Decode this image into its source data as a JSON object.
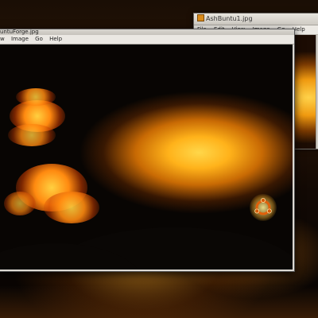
{
  "back_window": {
    "title": "AshBuntu1.jpg",
    "menu": [
      "File",
      "Edit",
      "View",
      "Image",
      "Go",
      "Help"
    ]
  },
  "main_window": {
    "title": "untuForge.jpg",
    "menu": [
      "w",
      "Image",
      "Go",
      "Help"
    ]
  },
  "icons": {
    "back_title_icon": "image-file-icon",
    "logo": "ubuntu-logo-icon"
  },
  "colors": {
    "lava_glow": "#ffb21a",
    "window_chrome": "#dcd9d3"
  }
}
